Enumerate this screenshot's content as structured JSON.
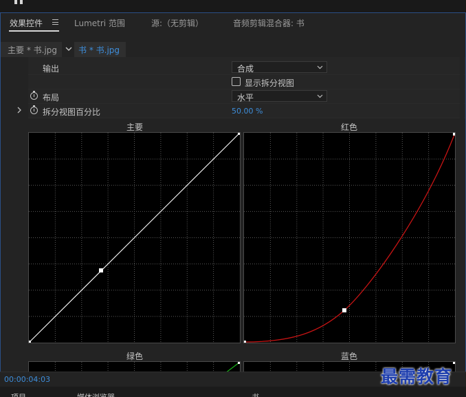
{
  "tabs": [
    {
      "label": "效果控件",
      "active": true
    },
    {
      "label": "Lumetri 范围"
    },
    {
      "label": "源:（无剪辑）"
    },
    {
      "label": "音频剪辑混合器: 书"
    }
  ],
  "clip": {
    "master": "主要 * 书.jpg",
    "current": "书 * 书.jpg"
  },
  "rows": {
    "output": {
      "label": "输出",
      "value": "合成"
    },
    "split_view": {
      "label": "显示拆分视图",
      "checked": false
    },
    "layout": {
      "label": "布局",
      "value": "水平"
    },
    "split_percent": {
      "label": "拆分视图百分比",
      "value": "50.00 %"
    }
  },
  "graphs": {
    "master": {
      "title": "主要",
      "curve_color": "#ffffff"
    },
    "red": {
      "title": "红色",
      "curve_color": "#c81414"
    },
    "green": {
      "title": "绿色",
      "curve_color": "#19b419"
    },
    "blue": {
      "title": "蓝色",
      "curve_color": "#1e5adc"
    }
  },
  "timecode": "00:00:04:03",
  "bottom": {
    "project": "项目",
    "media_browser": "媒体浏览器",
    "timeline": "书"
  },
  "watermark": "最需教育",
  "colors": {
    "accent_blue": "#3e8edb",
    "panel_border": "#2b4f86"
  }
}
